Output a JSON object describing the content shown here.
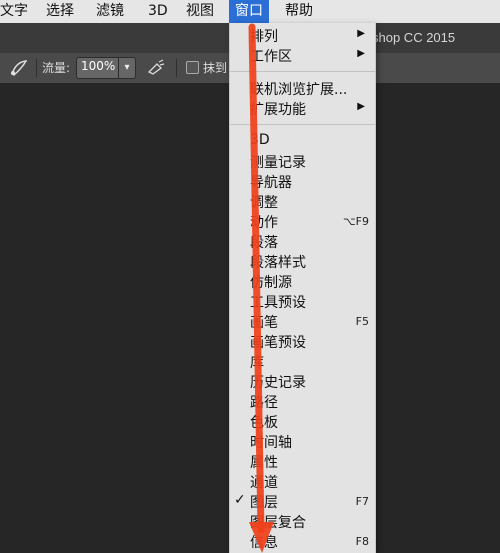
{
  "menubar": {
    "items": [
      {
        "label": "文字"
      },
      {
        "label": "选择"
      },
      {
        "label": "滤镜"
      },
      {
        "label": "3D"
      },
      {
        "label": "视图"
      },
      {
        "label": "窗口",
        "active": true
      },
      {
        "label": "帮助"
      }
    ]
  },
  "titlebar": {
    "title": "shop CC 2015"
  },
  "options": {
    "flow_label": "流量:",
    "flow_value": "100%",
    "smoothing_label": "抹到"
  },
  "window_menu": {
    "items": [
      {
        "label": "排列",
        "submenu": true
      },
      {
        "label": "工作区",
        "submenu": true
      },
      {
        "separator": true
      },
      {
        "label": "联机浏览扩展..."
      },
      {
        "label": "扩展功能",
        "submenu": true
      },
      {
        "separator": true
      },
      {
        "label": "3D"
      },
      {
        "label": "测量记录"
      },
      {
        "label": "导航器"
      },
      {
        "label": "调整"
      },
      {
        "label": "动作",
        "shortcut": "⌥F9"
      },
      {
        "label": "段落"
      },
      {
        "label": "段落样式"
      },
      {
        "label": "仿制源"
      },
      {
        "label": "工具预设"
      },
      {
        "label": "画笔",
        "shortcut": "F5"
      },
      {
        "label": "画笔预设"
      },
      {
        "label": "库"
      },
      {
        "label": "历史记录"
      },
      {
        "label": "路径"
      },
      {
        "label": "色板"
      },
      {
        "label": "时间轴"
      },
      {
        "label": "属性"
      },
      {
        "label": "通道"
      },
      {
        "label": "图层",
        "shortcut": "F7",
        "checked": true
      },
      {
        "label": "图层复合"
      },
      {
        "label": "信息",
        "shortcut": "F8"
      }
    ]
  },
  "annotation": {
    "color": "#f0401a"
  },
  "colors": {
    "menubar_active": "#2b6fd6"
  }
}
